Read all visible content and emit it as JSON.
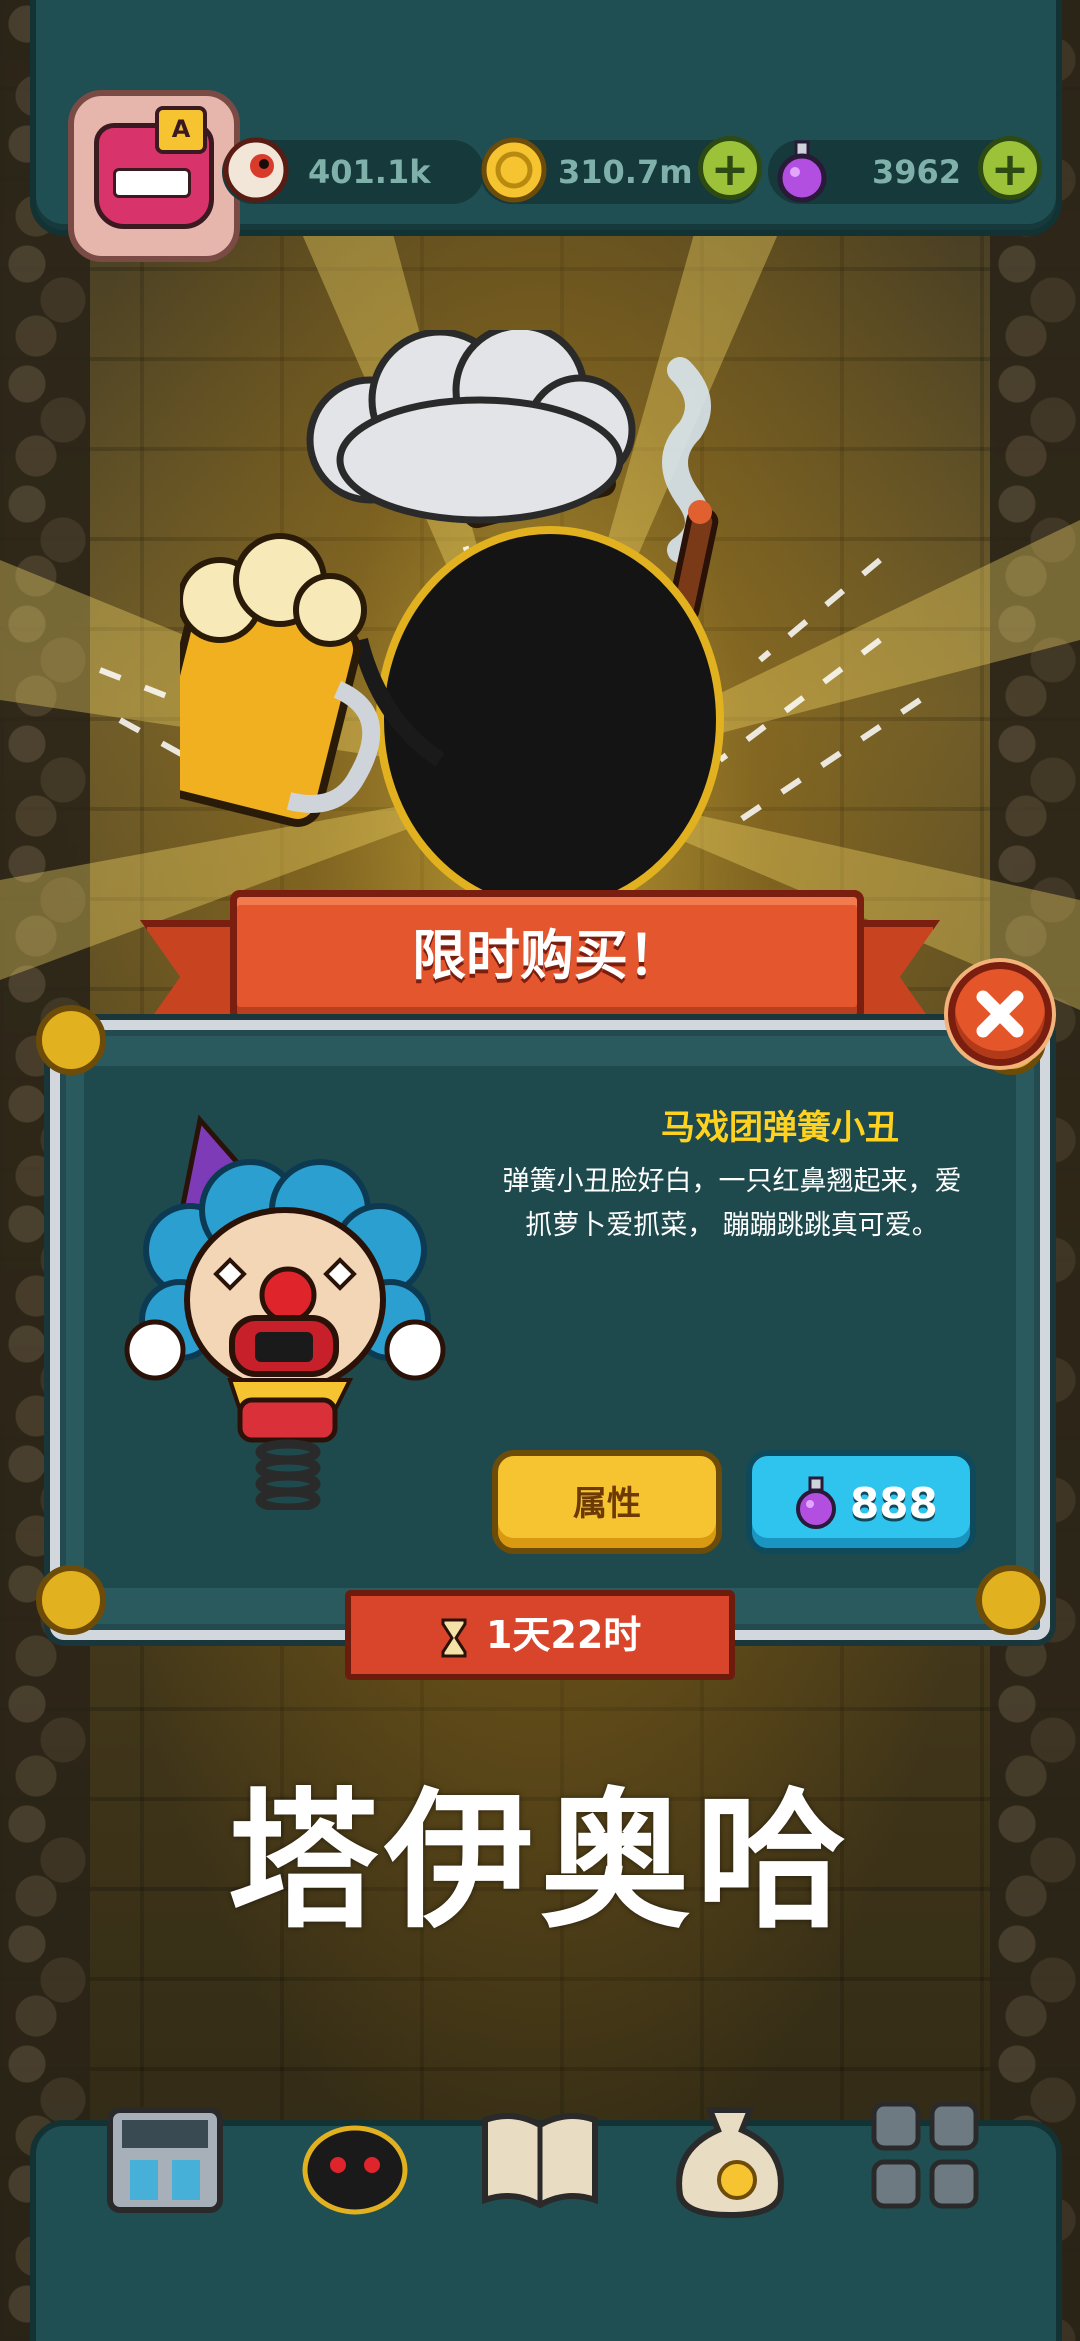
{
  "hud": {
    "resources": [
      {
        "icon": "eyeball-icon",
        "value": "401.1k"
      },
      {
        "icon": "gold-coin-icon",
        "value": "310.7m"
      },
      {
        "icon": "purple-potion-icon",
        "value": "3962"
      }
    ],
    "avatar_badge": "A"
  },
  "offer": {
    "banner": "限时购买！",
    "item_name": "马戏团弹簧小丑",
    "description": "弹簧小丑脸好白，一只红鼻翘起来，爱抓萝卜爱抓菜， 蹦蹦跳跳真可爱。",
    "attr_button": "属性",
    "price": "888",
    "timer": "1天22时"
  },
  "caption": "塔伊奥哈",
  "bottom_nav": [
    {
      "icon": "shop-icon"
    },
    {
      "icon": "monsters-icon"
    },
    {
      "icon": "book-icon"
    },
    {
      "icon": "money-bag-icon"
    },
    {
      "icon": "grid-menu-icon"
    }
  ],
  "colors": {
    "hud_bg": "#1f4f52",
    "banner_red": "#e4572e",
    "title_yellow": "#ffd21f",
    "buy_blue": "#2fc4ee",
    "attr_yellow": "#f5c430"
  }
}
